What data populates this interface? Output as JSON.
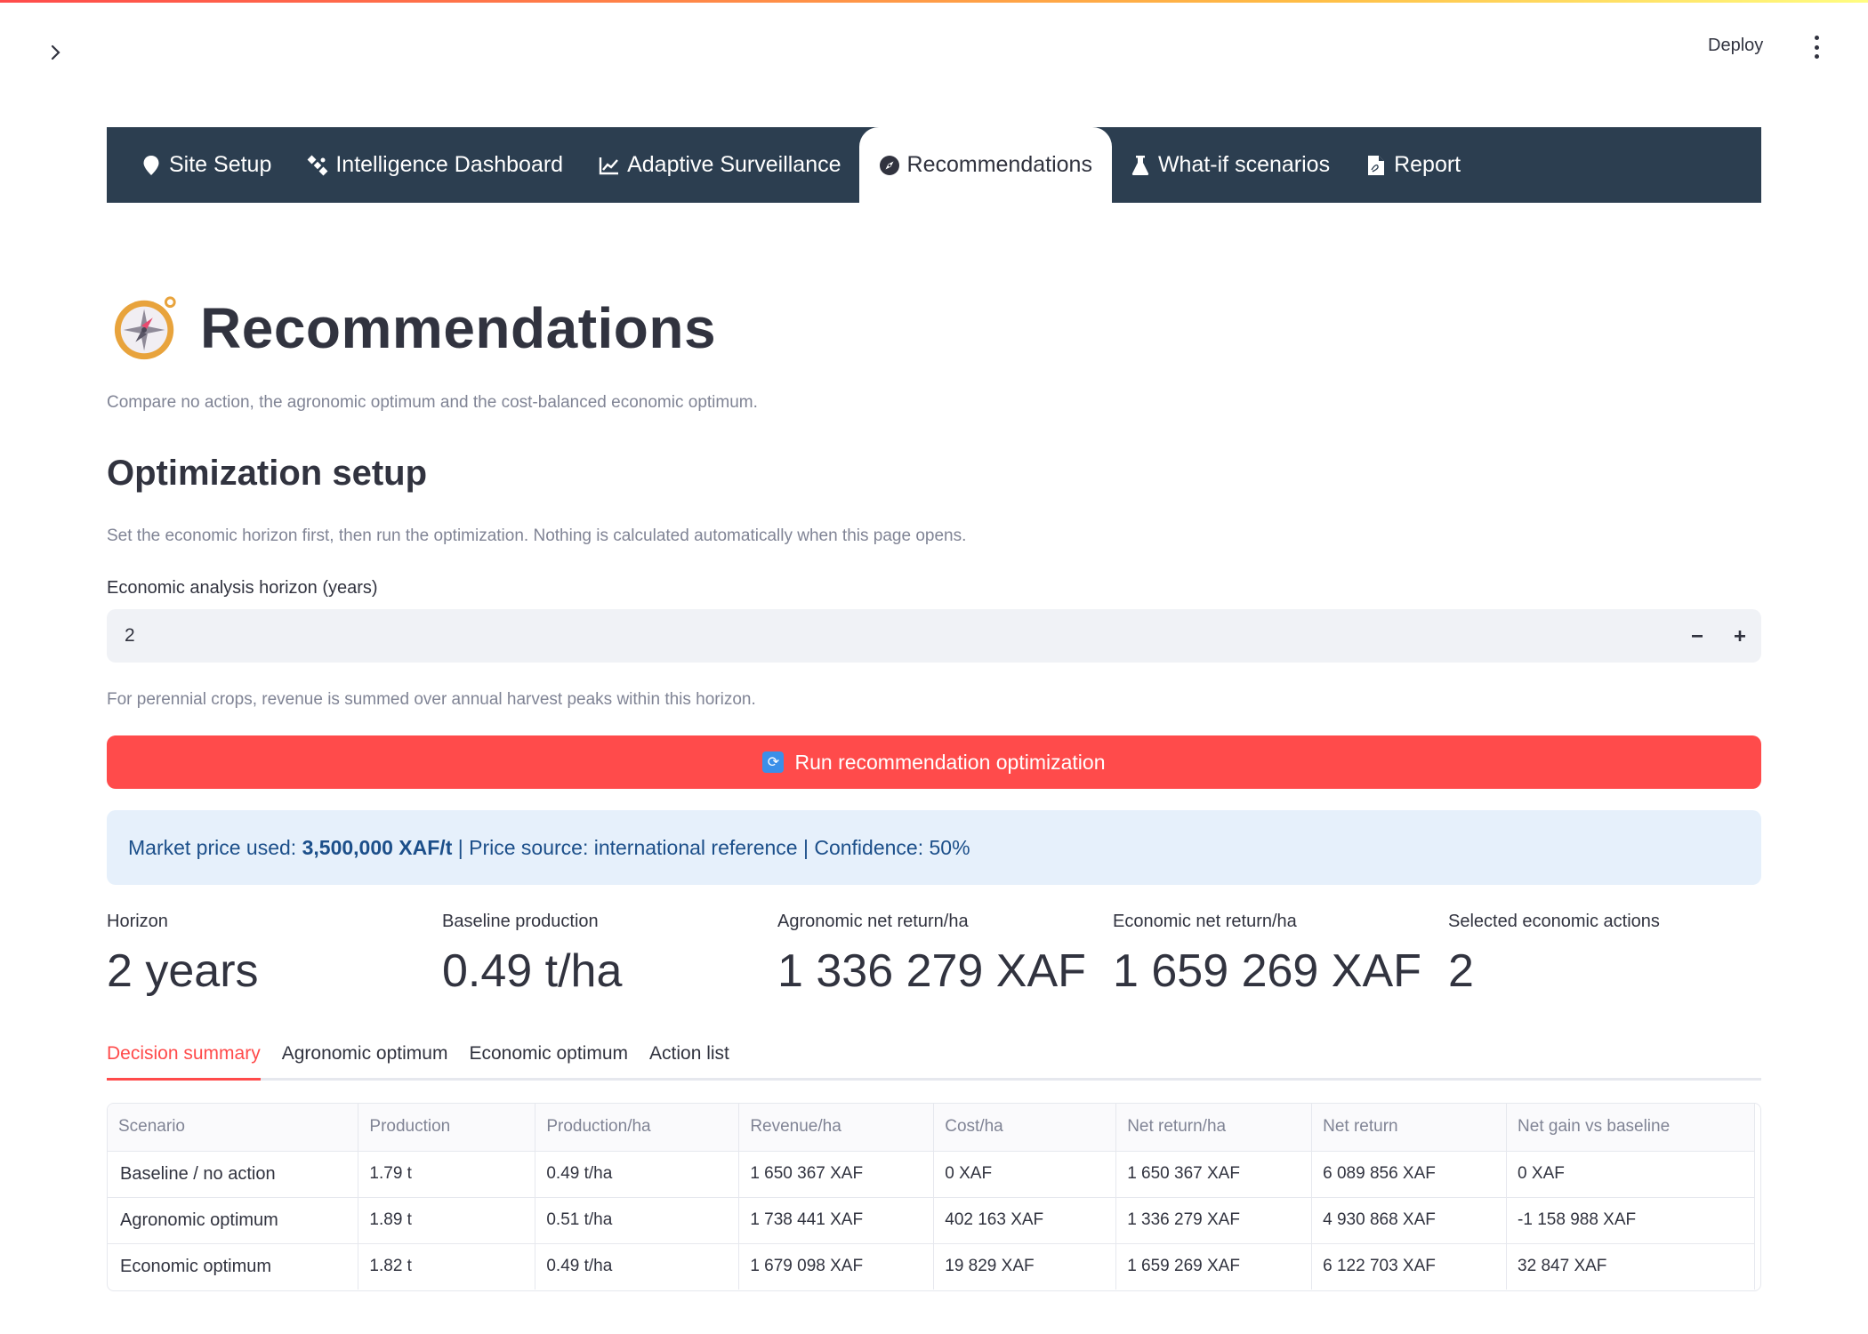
{
  "header": {
    "deploy_label": "Deploy"
  },
  "nav": {
    "tabs": [
      {
        "label": "Site Setup",
        "icon": "map-pin-icon"
      },
      {
        "label": "Intelligence Dashboard",
        "icon": "satellite-icon"
      },
      {
        "label": "Adaptive Surveillance",
        "icon": "chart-line-icon"
      },
      {
        "label": "Recommendations",
        "icon": "compass-icon",
        "active": true
      },
      {
        "label": "What-if scenarios",
        "icon": "flask-icon"
      },
      {
        "label": "Report",
        "icon": "pdf-file-icon"
      }
    ]
  },
  "page": {
    "title": "Recommendations",
    "subtitle": "Compare no action, the agronomic optimum and the cost-balanced economic optimum."
  },
  "setup": {
    "heading": "Optimization setup",
    "description": "Set the economic horizon first, then run the optimization. Nothing is calculated automatically when this page opens.",
    "horizon_label": "Economic analysis horizon (years)",
    "horizon_value": "2",
    "horizon_help": "For perennial crops, revenue is summed over annual harvest peaks within this horizon.",
    "run_label": "Run recommendation optimization"
  },
  "info": {
    "prefix": "Market price used: ",
    "price": "3,500,000 XAF/t",
    "suffix": " | Price source: international reference | Confidence: 50%"
  },
  "metrics": [
    {
      "label": "Horizon",
      "value": "2 years"
    },
    {
      "label": "Baseline production",
      "value": "0.49 t/ha"
    },
    {
      "label": "Agronomic net return/ha",
      "value": "1 336 279 XAF"
    },
    {
      "label": "Economic net return/ha",
      "value": "1 659 269 XAF"
    },
    {
      "label": "Selected economic actions",
      "value": "2"
    }
  ],
  "subtabs": [
    "Decision summary",
    "Agronomic optimum",
    "Economic optimum",
    "Action list"
  ],
  "table": {
    "headers": [
      "Scenario",
      "Production",
      "Production/ha",
      "Revenue/ha",
      "Cost/ha",
      "Net return/ha",
      "Net return",
      "Net gain vs baseline"
    ],
    "rows": [
      [
        "Baseline / no action",
        "1.79 t",
        "0.49 t/ha",
        "1 650 367 XAF",
        "0 XAF",
        "1 650 367 XAF",
        "6 089 856 XAF",
        "0 XAF"
      ],
      [
        "Agronomic optimum",
        "1.89 t",
        "0.51 t/ha",
        "1 738 441 XAF",
        "402 163 XAF",
        "1 336 279 XAF",
        "4 930 868 XAF",
        "-1 158 988 XAF"
      ],
      [
        "Economic optimum",
        "1.82 t",
        "0.49 t/ha",
        "1 679 098 XAF",
        "19 829 XAF",
        "1 659 269 XAF",
        "6 122 703 XAF",
        "32 847 XAF"
      ]
    ]
  },
  "colors": {
    "accent": "#ff4b4b",
    "nav_bg": "#2c3e50",
    "info_bg": "#e6f0fb",
    "info_text": "#1c4f8a"
  }
}
